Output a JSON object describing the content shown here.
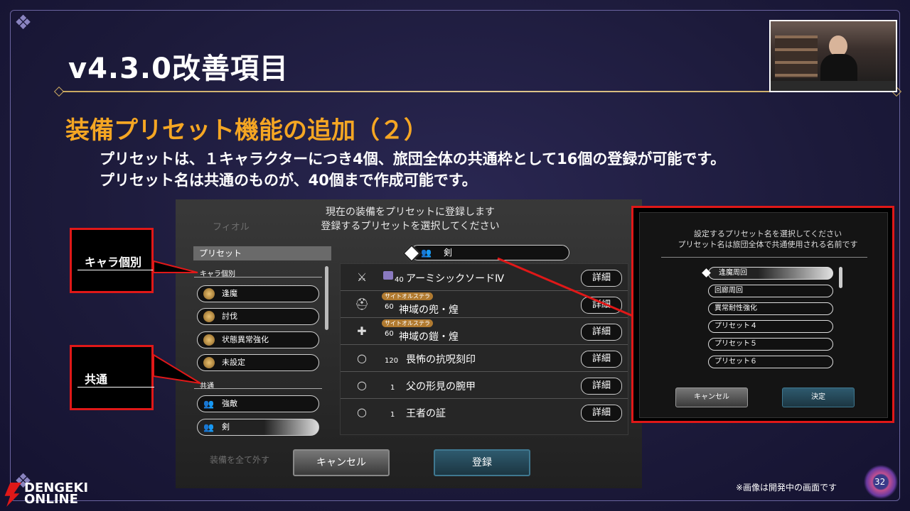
{
  "slide": {
    "title": "v4.3.0改善項目",
    "subtitle": "装備プリセット機能の追加（２）",
    "body_lines": [
      "プリセットは、１キャラクターにつき4個、旅団全体の共通枠として16個の登録が可能です。",
      "プリセット名は共通のものが、40個まで作成可能です。"
    ],
    "note": "※画像は開発中の画面です",
    "page_number": "32"
  },
  "game": {
    "ghost_name": "フィオル",
    "prompt_lines": [
      "現在の装備をプリセットに登録します",
      "登録するプリセットを選択してください"
    ],
    "preset_header": "プリセット",
    "section_individual": "キャラ個別",
    "section_common": "共通",
    "individual_presets": [
      "逢魔",
      "討伐",
      "状態異常強化",
      "未設定"
    ],
    "common_presets": [
      "強敵",
      "剣"
    ],
    "selected_name": "剣",
    "equipment": [
      {
        "level": "40",
        "name": "アーミシックソードⅣ",
        "tag": "",
        "slot": "sword-icon",
        "glyph": "⚔"
      },
      {
        "level": "60",
        "name": "神域の兜・煌",
        "tag": "サイトオルステラ",
        "slot": "helmet-icon",
        "glyph": "⛑"
      },
      {
        "level": "60",
        "name": "神域の鎧・煌",
        "tag": "サイトオルステラ",
        "slot": "armor-icon",
        "glyph": "✚"
      },
      {
        "level": "120",
        "name": "畏怖の抗呪刻印",
        "tag": "",
        "slot": "accessory-icon",
        "glyph": "○"
      },
      {
        "level": "1",
        "name": "父の形見の腕甲",
        "tag": "",
        "slot": "accessory-icon",
        "glyph": "○"
      },
      {
        "level": "1",
        "name": "王者の証",
        "tag": "",
        "slot": "accessory-icon",
        "glyph": "○"
      }
    ],
    "detail_label": "詳細",
    "cancel_label": "キャンセル",
    "register_label": "登録",
    "remove_all_label": "装備を全て外す"
  },
  "callouts": {
    "individual": "キャラ個別",
    "common": "共通"
  },
  "name_panel": {
    "prompt_lines": [
      "設定するプリセット名を選択してください",
      "プリセット名は旅団全体で共通使用される名前です"
    ],
    "items": [
      "逢魔周回",
      "回廊周回",
      "異常耐性強化",
      "プリセット４",
      "プリセット５",
      "プリセット６"
    ],
    "cancel_label": "キャンセル",
    "confirm_label": "決定"
  },
  "logo": {
    "line1": "DENGEKI",
    "line2": "ONLINE"
  },
  "colors": {
    "accent_orange": "#f5a623",
    "callout_red": "#e01818",
    "rule_gold": "#c9a860"
  }
}
